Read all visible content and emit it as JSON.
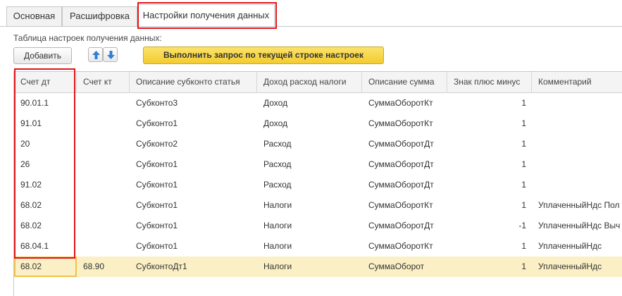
{
  "tabs": [
    {
      "label": "Основная"
    },
    {
      "label": "Расшифровка"
    },
    {
      "label": "Настройки получения данных"
    }
  ],
  "caption": "Таблица настроек получения данных:",
  "toolbar": {
    "add_label": "Добавить",
    "up_icon": "arrow-up-icon",
    "down_icon": "arrow-down-icon",
    "execute_label": "Выполнить запрос по текущей строке настроек"
  },
  "table": {
    "columns": [
      "Счет дт",
      "Счет кт",
      "Описание субконто статья",
      "Доход расход налоги",
      "Описание сумма",
      "Знак плюс минус",
      "Комментарий"
    ],
    "rows": [
      [
        "90.01.1",
        "",
        "Субконто3",
        "Доход",
        "СуммаОборотКт",
        "1",
        ""
      ],
      [
        "91.01",
        "",
        "Субконто1",
        "Доход",
        "СуммаОборотКт",
        "1",
        ""
      ],
      [
        "20",
        "",
        "Субконто2",
        "Расход",
        "СуммаОборотДт",
        "1",
        ""
      ],
      [
        "26",
        "",
        "Субконто1",
        "Расход",
        "СуммаОборотДт",
        "1",
        ""
      ],
      [
        "91.02",
        "",
        "Субконто1",
        "Расход",
        "СуммаОборотДт",
        "1",
        ""
      ],
      [
        "68.02",
        "",
        "Субконто1",
        "Налоги",
        "СуммаОборотКт",
        "1",
        "УплаченныйНдс Пол"
      ],
      [
        "68.02",
        "",
        "Субконто1",
        "Налоги",
        "СуммаОборотДт",
        "-1",
        "УплаченныйНдс Выч"
      ],
      [
        "68.04.1",
        "",
        "Субконто1",
        "Налоги",
        "СуммаОборотКт",
        "1",
        "УплаченныйНдс"
      ],
      [
        "68.02",
        "68.90",
        "СубконтоДт1",
        "Налоги",
        "СуммаОборот",
        "1",
        "УплаченныйНдс"
      ]
    ],
    "selected_row": 8
  },
  "colors": {
    "highlight_red": "#e3141b",
    "execute_button": "#f3cc2f",
    "selected_row": "#fbf0c5",
    "arrow_blue": "#2f7fd6"
  }
}
